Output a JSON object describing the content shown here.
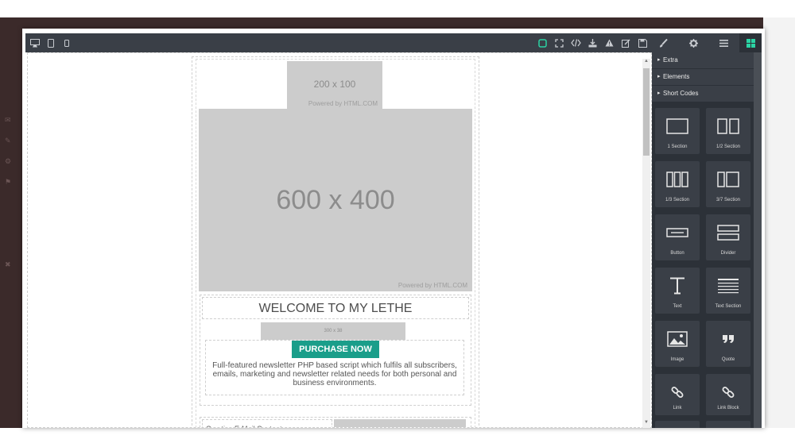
{
  "canvas": {
    "logo_placeholder": {
      "size_text": "200 x 100",
      "powered_text": "Powered by HTML.COM"
    },
    "hero_placeholder": {
      "size_text": "600 x 400",
      "powered_text": "Powered by HTML.COM"
    },
    "welcome_heading": "WELCOME TO MY LETHE",
    "small_placeholder_text": "300 x 38",
    "purchase_button_label": "PURCHASE NOW",
    "description": "Full-featured newsletter PHP based script which fulfils all subscribers, emails, marketing and newsletter related needs for both personal and business environments.",
    "creative_heading": "Creative E-Mail Contents"
  },
  "panel": {
    "accordions": [
      {
        "label": "Extra"
      },
      {
        "label": "Elements"
      },
      {
        "label": "Short Codes"
      }
    ],
    "tiles": [
      {
        "label": "1 Section",
        "icon": "one-section-icon"
      },
      {
        "label": "1/2 Section",
        "icon": "half-section-icon"
      },
      {
        "label": "1/3 Section",
        "icon": "third-section-icon"
      },
      {
        "label": "3/7 Section",
        "icon": "three-seven-section-icon"
      },
      {
        "label": "Button",
        "icon": "button-icon"
      },
      {
        "label": "Divider",
        "icon": "divider-icon"
      },
      {
        "label": "Text",
        "icon": "text-icon"
      },
      {
        "label": "Text Section",
        "icon": "text-section-icon"
      },
      {
        "label": "Image",
        "icon": "image-icon"
      },
      {
        "label": "Quote",
        "icon": "quote-icon"
      },
      {
        "label": "Link",
        "icon": "link-icon"
      },
      {
        "label": "Link Block",
        "icon": "link-block-icon"
      }
    ]
  },
  "colors": {
    "toolbar_bg": "#3a3f47",
    "panel_bg": "#2c3138",
    "accent_green": "#1a9e8a",
    "placeholder_gray": "#cccccc"
  }
}
